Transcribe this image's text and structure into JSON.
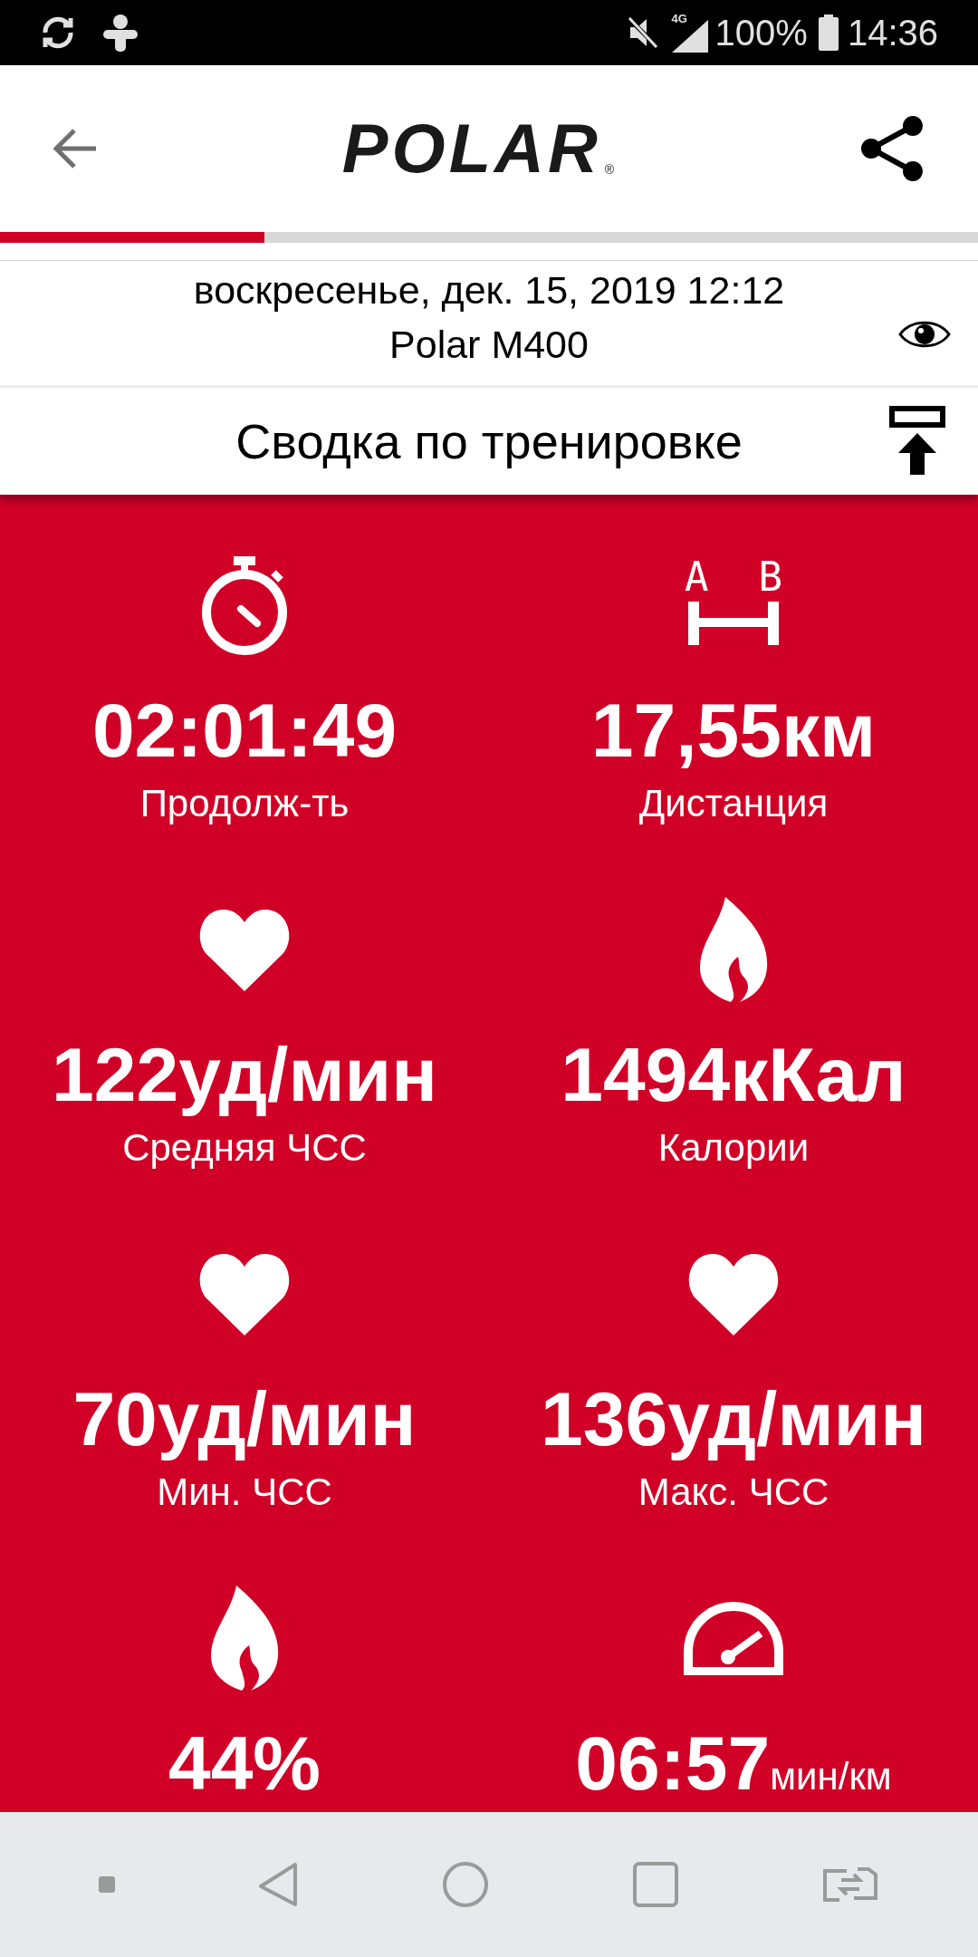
{
  "status_bar": {
    "network": "4G",
    "battery": "100%",
    "time": "14:36"
  },
  "header": {
    "logo": "POLAR",
    "logo_mark": "®"
  },
  "progress": {
    "level": 0.27
  },
  "session": {
    "date": "воскресенье, дек. 15, 2019 12:12",
    "device": "Polar M400"
  },
  "section": {
    "title": "Сводка по тренировке"
  },
  "distance_icon": {
    "markers": [
      "A",
      "B"
    ]
  },
  "stats": [
    {
      "kind": "duration",
      "value": "02:01:49",
      "label": "Продолж-ть"
    },
    {
      "kind": "distance",
      "value": "17,55км",
      "label": "Дистанция"
    },
    {
      "kind": "heartrate",
      "value": "122уд/мин",
      "label": "Средняя ЧСС"
    },
    {
      "kind": "energy",
      "value": "1494кКал",
      "label": "Калории"
    },
    {
      "kind": "heartrate",
      "value": "70уд/мин",
      "label": "Мин. ЧСС"
    },
    {
      "kind": "heartrate",
      "value": "136уд/мин",
      "label": "Макс. ЧСС"
    },
    {
      "kind": "energy",
      "value": "44%"
    },
    {
      "kind": "pace",
      "value": "06:57",
      "unit": "мин/км"
    }
  ]
}
